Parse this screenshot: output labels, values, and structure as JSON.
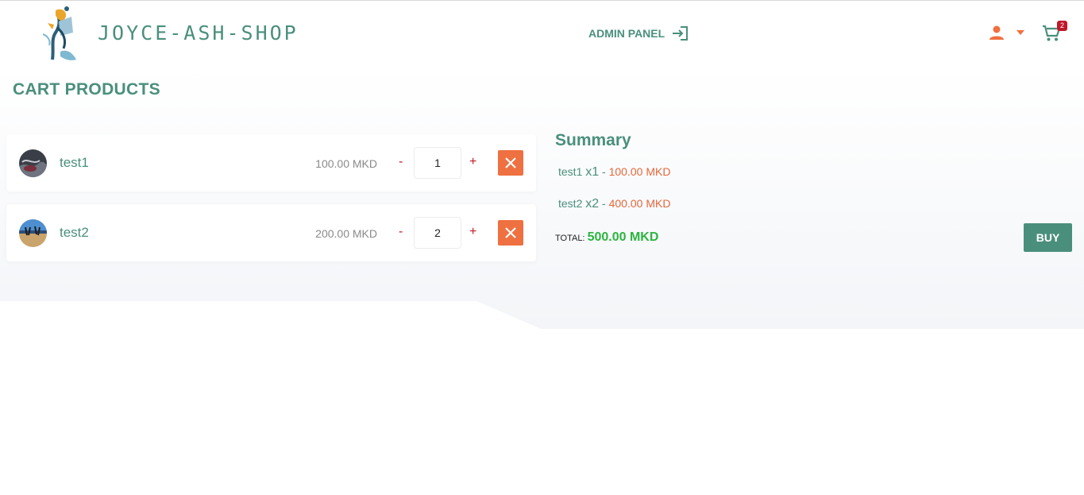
{
  "header": {
    "brand": "JOYCE-ASH-SHOP",
    "admin_label": "ADMIN PANEL",
    "cart_count": "2"
  },
  "page": {
    "title": "CART PRODUCTS"
  },
  "cart": {
    "items": [
      {
        "name": "test1",
        "price": "100.00 MKD",
        "qty": "1",
        "minus": "-",
        "plus": "+"
      },
      {
        "name": "test2",
        "price": "200.00 MKD",
        "qty": "2",
        "minus": "-",
        "plus": "+"
      }
    ]
  },
  "summary": {
    "title": "Summary",
    "lines": [
      {
        "name": "test1",
        "qty": "x1",
        "sep": " - ",
        "amount": "100.00 MKD"
      },
      {
        "name": "test2",
        "qty": "x2",
        "sep": " - ",
        "amount": "400.00 MKD"
      }
    ],
    "total_label": "TOTAL:",
    "total_value": "500.00 MKD",
    "buy_label": "BUY"
  },
  "colors": {
    "primary": "#4a8f7c",
    "accent": "#ef7040",
    "danger": "#c0182a",
    "total": "#2ab53f"
  },
  "icons": [
    "logo-image",
    "login-arrow-icon",
    "user-icon",
    "caret-down-icon",
    "cart-icon",
    "close-icon"
  ]
}
